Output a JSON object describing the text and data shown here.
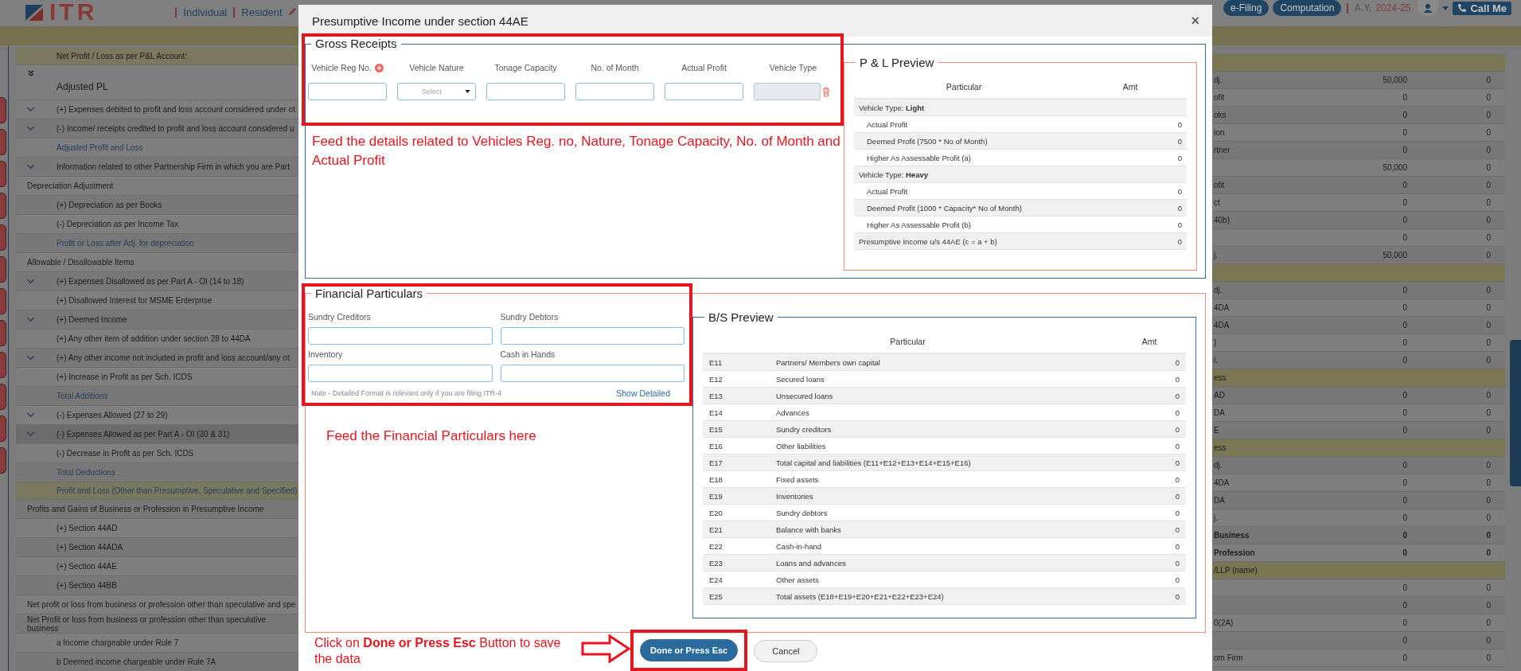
{
  "header": {
    "logo": "ITR",
    "links": [
      "Individual",
      "Resident"
    ],
    "buttons": [
      "e-Filing",
      "Computation"
    ],
    "ay_label": "A.Y.",
    "ay_value": "2024-25",
    "call_button": "Call Me"
  },
  "left_table": {
    "rows": [
      {
        "kind": "highlight",
        "label": "Net Profit / Loss as per P&L Account:",
        "selected": false
      },
      {
        "kind": "heading",
        "label": "Adjusted PL",
        "selected": false
      },
      {
        "kind": "expand",
        "label": "(+) Expenses debited to profit and loss account considered under ot",
        "selected": false
      },
      {
        "kind": "expand",
        "label": "(-) Income/ receipts credited to profit and loss account considered u",
        "selected": false
      },
      {
        "kind": "total",
        "label": "Adjusted Profit and Loss",
        "selected": false
      },
      {
        "kind": "expand",
        "label": "Information related to other Partnership Firm in which you are Part",
        "selected": false
      },
      {
        "kind": "section",
        "label": "Depreciation Adjustment",
        "selected": false
      },
      {
        "kind": "item",
        "label": "(+) Depreciation as per Books",
        "selected": false
      },
      {
        "kind": "item",
        "label": "(-) Depreciation as per Income Tax",
        "selected": false
      },
      {
        "kind": "total",
        "label": "Profit or Loss after Adj. for depreciation",
        "selected": false
      },
      {
        "kind": "section",
        "label": "Allowable / Disallowable Items",
        "selected": false
      },
      {
        "kind": "expand",
        "label": "(+) Expenses Disallowed as per Part A - OI (14 to 18)",
        "selected": false
      },
      {
        "kind": "item",
        "label": "(+) Disallowed Interest for MSME Enterprise",
        "selected": false
      },
      {
        "kind": "expand",
        "label": "(+) Deemed Income",
        "selected": false
      },
      {
        "kind": "item",
        "label": "(+) Any other item of addition under section 28 to 44DA",
        "selected": false
      },
      {
        "kind": "expand",
        "label": "(+) Any other income not included in profit and loss account/any ot",
        "selected": false
      },
      {
        "kind": "item",
        "label": "(+) Increase in Profit as per Sch. ICDS",
        "selected": false
      },
      {
        "kind": "total",
        "label": "Total Additions",
        "selected": false
      },
      {
        "kind": "expand",
        "label": "(-) Expenses Allowed (27 to 29)",
        "selected": false
      },
      {
        "kind": "expand",
        "label": "(-) Expenses Allowed as per Part A - OI (30 & 31)",
        "selected": true
      },
      {
        "kind": "item",
        "label": "(-) Decrease in Profit as per Sch. ICDS",
        "selected": false
      },
      {
        "kind": "total",
        "label": "Total Deductions",
        "selected": false
      },
      {
        "kind": "total-highlight",
        "label": "Profit and Loss (Other than Presumptive, Speculative and Specified)",
        "selected": false
      },
      {
        "kind": "section",
        "label": "Profits and Gains of Business or Profession in Presumptive Income",
        "selected": false
      },
      {
        "kind": "item",
        "label": "(+) Section 44AD",
        "selected": false
      },
      {
        "kind": "item",
        "label": "(+) Section 44ADA",
        "selected": false
      },
      {
        "kind": "item",
        "label": "(+) Section 44AE",
        "selected": false
      },
      {
        "kind": "item",
        "label": "(+) Section 44BB",
        "selected": false
      },
      {
        "kind": "section",
        "label": "Net profit or loss from business or profession other than speculative and spe",
        "selected": false
      },
      {
        "kind": "section",
        "label": "Net Profit or loss from business or profession other than speculative business",
        "selected": false
      },
      {
        "kind": "item",
        "label": "a Income chargeable under Rule 7",
        "selected": false
      },
      {
        "kind": "item",
        "label": "b Deemed income chargeable under Rule 7A",
        "selected": false
      }
    ]
  },
  "right_table": {
    "rows": [
      {
        "kind": "section"
      },
      {
        "kind": "row",
        "label": "dj.",
        "values": [
          "50,000",
          "0"
        ]
      },
      {
        "kind": "row",
        "label": "ofit",
        "values": [
          "0",
          "0"
        ]
      },
      {
        "kind": "row",
        "label": "oks",
        "values": [
          "0",
          "0"
        ]
      },
      {
        "kind": "row",
        "label": "ion",
        "values": [
          "0",
          "0"
        ]
      },
      {
        "kind": "row",
        "label": "rtner",
        "values": [
          "0",
          "0"
        ]
      },
      {
        "kind": "row",
        "values": [
          "50,000",
          "0"
        ]
      },
      {
        "kind": "row",
        "label": "ofit",
        "values": [
          "0",
          "0"
        ]
      },
      {
        "kind": "row",
        "label": "ct",
        "values": [
          "0",
          "0"
        ]
      },
      {
        "kind": "row",
        "label": "40b)",
        "values": [
          "0",
          "0"
        ]
      },
      {
        "kind": "row",
        "values": [
          "0",
          "0"
        ]
      },
      {
        "kind": "row",
        "label": "j.",
        "values": [
          "50,000",
          "0"
        ]
      },
      {
        "kind": "section"
      },
      {
        "kind": "row",
        "label": "dj.",
        "values": [
          "0",
          "0"
        ]
      },
      {
        "kind": "row",
        "label": "4DA",
        "values": [
          "0",
          "0"
        ]
      },
      {
        "kind": "row",
        "label": "4DA",
        "values": [
          "0",
          "0"
        ]
      },
      {
        "kind": "row",
        "label": ")",
        "values": [
          "0",
          "0"
        ]
      },
      {
        "kind": "row",
        "label": "i.",
        "values": [
          "0",
          "0"
        ]
      },
      {
        "kind": "section",
        "label": "ess"
      },
      {
        "kind": "row",
        "label": "AD",
        "values": [
          "0",
          "0"
        ]
      },
      {
        "kind": "row",
        "label": "DA",
        "values": [
          "0",
          "0"
        ]
      },
      {
        "kind": "row",
        "label": "E",
        "values": [
          "0",
          "0"
        ]
      },
      {
        "kind": "section",
        "label": "ess"
      },
      {
        "kind": "row",
        "label": "dj.",
        "values": [
          "0",
          "0"
        ]
      },
      {
        "kind": "row",
        "label": "4DA",
        "values": [
          "0",
          "0"
        ]
      },
      {
        "kind": "row",
        "label": "DA",
        "values": [
          "0",
          "0"
        ]
      },
      {
        "kind": "row",
        "label": "j.",
        "values": [
          "0",
          "0"
        ]
      },
      {
        "kind": "bold",
        "label": "Business",
        "values": [
          "0",
          "0"
        ]
      },
      {
        "kind": "bold",
        "label": "Profession",
        "values": [
          "0",
          "0"
        ]
      },
      {
        "kind": "section",
        "label": "/LLP (name)"
      },
      {
        "kind": "row",
        "values": [
          "0",
          "0"
        ]
      },
      {
        "kind": "row",
        "values": [
          "0",
          "0"
        ]
      },
      {
        "kind": "row",
        "label": "0(2A)",
        "values": [
          "0",
          "0"
        ]
      },
      {
        "kind": "row",
        "values": [
          "0",
          "0"
        ]
      },
      {
        "kind": "row",
        "label": "om Firm",
        "values": [
          "0",
          "0"
        ]
      }
    ]
  },
  "modal": {
    "title": "Presumptive Income under section 44AE",
    "close": "×",
    "gross_receipts": {
      "legend": "Gross Receipts",
      "columns": [
        {
          "label": "Vehicle Reg No.",
          "kind": "reg"
        },
        {
          "label": "Vehicle Nature",
          "kind": "select",
          "placeholder": "Select"
        },
        {
          "label": "Tonage Capacity",
          "kind": "input"
        },
        {
          "label": "No. of Month",
          "kind": "input"
        },
        {
          "label": "Actual Profit",
          "kind": "input"
        },
        {
          "label": "Vehicle Type",
          "kind": "readonly"
        }
      ]
    },
    "pl_preview": {
      "legend": "P & L Preview",
      "columns": [
        "Particular",
        "Amt"
      ],
      "rows": [
        {
          "kind": "group",
          "label": "Vehicle Type: **Light**"
        },
        {
          "kind": "item",
          "label": "Actual Profit",
          "amount": "0"
        },
        {
          "kind": "item",
          "label": "Deemed Profit (7500 * No of Month)",
          "amount": "0"
        },
        {
          "kind": "item",
          "label": "Higher As Assessable Profit (a)",
          "amount": "0"
        },
        {
          "kind": "group",
          "label": "Vehicle Type: **Heavy**"
        },
        {
          "kind": "item",
          "label": "Actual Profit",
          "amount": "0"
        },
        {
          "kind": "item",
          "label": "Deemed Profit (1000 * Capacity* No of Month)",
          "amount": "0"
        },
        {
          "kind": "item",
          "label": "Higher As Assessable Profit (b)",
          "amount": "0"
        },
        {
          "kind": "total",
          "label": "Presumptive Income u/s 44AE (c = a + b)",
          "amount": "0"
        }
      ]
    },
    "financial": {
      "legend": "Financial Particulars",
      "fields": [
        {
          "label": "Sundry Creditors"
        },
        {
          "label": "Sundry Debtors"
        },
        {
          "label": "Inventory"
        },
        {
          "label": "Cash in Hands"
        }
      ],
      "note": "Note - Detailed Format is relevant only if you are filing ITR-4",
      "link": "Show Detailed"
    },
    "bs_preview": {
      "legend": "B/S Preview",
      "columns": [
        "Particular",
        "Amt"
      ],
      "rows": [
        {
          "code": "E11",
          "label": "Partners/ Members own capital",
          "amount": "0"
        },
        {
          "code": "E12",
          "label": "Secured loans",
          "amount": "0"
        },
        {
          "code": "E13",
          "label": "Unsecured loans",
          "amount": "0"
        },
        {
          "code": "E14",
          "label": "Advances",
          "amount": "0"
        },
        {
          "code": "E15",
          "label": "Sundry creditors",
          "amount": "0"
        },
        {
          "code": "E16",
          "label": "Other liabilities",
          "amount": "0"
        },
        {
          "code": "E17",
          "label": "Total capital and liabilities (E11+E12+E13+E14+E15+E16)",
          "amount": "0"
        },
        {
          "code": "E18",
          "label": "Fixed assets",
          "amount": "0"
        },
        {
          "code": "E19",
          "label": "Inventories",
          "amount": "0"
        },
        {
          "code": "E20",
          "label": "Sundry debtors",
          "amount": "0"
        },
        {
          "code": "E21",
          "label": "Balance with banks",
          "amount": "0"
        },
        {
          "code": "E22",
          "label": "Cash-in-hand",
          "amount": "0"
        },
        {
          "code": "E23",
          "label": "Loans and advances",
          "amount": "0"
        },
        {
          "code": "E24",
          "label": "Other assets",
          "amount": "0"
        },
        {
          "code": "E25",
          "label": "Total assets (E18+E19+E20+E21+E22+E23+E24)",
          "amount": "0"
        }
      ]
    },
    "buttons": [
      {
        "label": "Done or Press Esc",
        "kind": "primary"
      },
      {
        "label": "Cancel",
        "kind": "secondary"
      }
    ]
  },
  "annotations": {
    "gross": "Feed the details related to Vehicles Reg. no, Nature, Tonage Capacity, No. of Month and Actual Profit",
    "financial": "Feed the Financial Particulars here",
    "footer": "Click on **Done or Press Esc** Button to save the data"
  }
}
